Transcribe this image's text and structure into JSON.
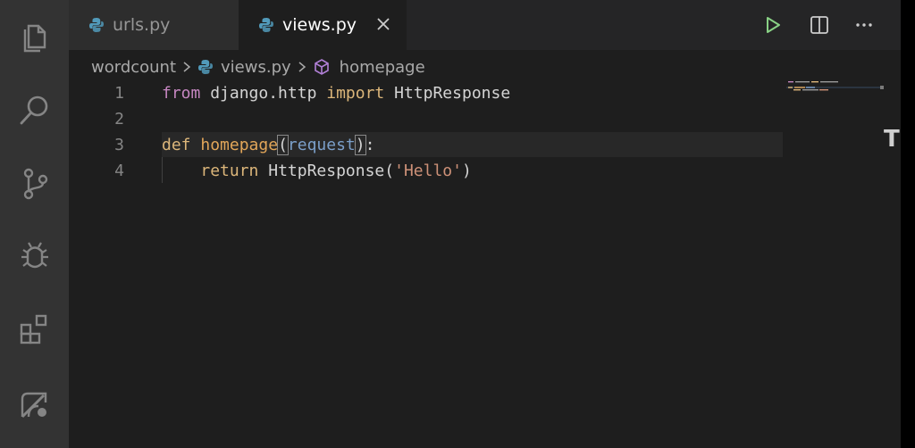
{
  "tabs": [
    {
      "label": "urls.py",
      "active": false
    },
    {
      "label": "views.py",
      "active": true
    }
  ],
  "breadcrumb": {
    "folder": "wordcount",
    "file": "views.py",
    "symbol": "homepage"
  },
  "code_lines": [
    {
      "num": "1"
    },
    {
      "num": "2"
    },
    {
      "num": "3"
    },
    {
      "num": "4"
    }
  ],
  "tokens": {
    "l1_from": "from",
    "l1_mod": " django.http ",
    "l1_import": "import",
    "l1_cls": " HttpResponse",
    "l3_def": "def",
    "l3_name": "homepage",
    "l3_open": "(",
    "l3_param": "request",
    "l3_close": ")",
    "l3_colon": ":",
    "l4_return": "return",
    "l4_call": " HttpResponse(",
    "l4_str": "'Hello'",
    "l4_close": ")"
  },
  "scrollbar_glyph": "T",
  "colors": {
    "activity_bar": "#333333",
    "editor_bg": "#1e1e1e",
    "run_icon": "#89d185",
    "keyword": "#c586c0",
    "function": "#e2a659",
    "string": "#ce9178",
    "symbol_cube": "#b180d7"
  },
  "icons": {
    "activity": [
      "files-icon",
      "search-icon",
      "source-control-icon",
      "debug-icon",
      "extensions-icon",
      "remote-icon"
    ],
    "toolbar": [
      "run-icon",
      "split-editor-icon",
      "more-actions-icon"
    ]
  }
}
